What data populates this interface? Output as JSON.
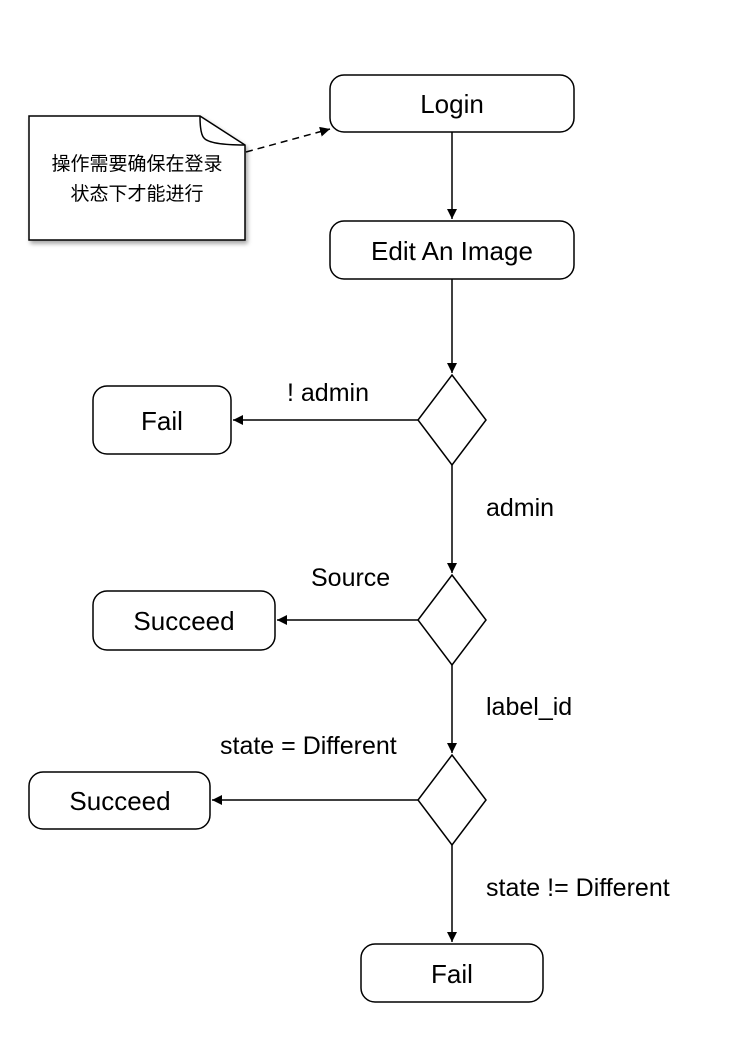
{
  "nodes": {
    "login": "Login",
    "edit_image": "Edit An Image",
    "fail_admin": "Fail",
    "succeed_source": "Succeed",
    "succeed_state": "Succeed",
    "fail_final": "Fail"
  },
  "edges": {
    "not_admin": "! admin",
    "admin": "admin",
    "source": "Source",
    "label_id": "label_id",
    "state_different": "state = Different",
    "state_not_different": "state != Different"
  },
  "note": {
    "line1": "操作需要确保在登录",
    "line2": "状态下才能进行"
  }
}
